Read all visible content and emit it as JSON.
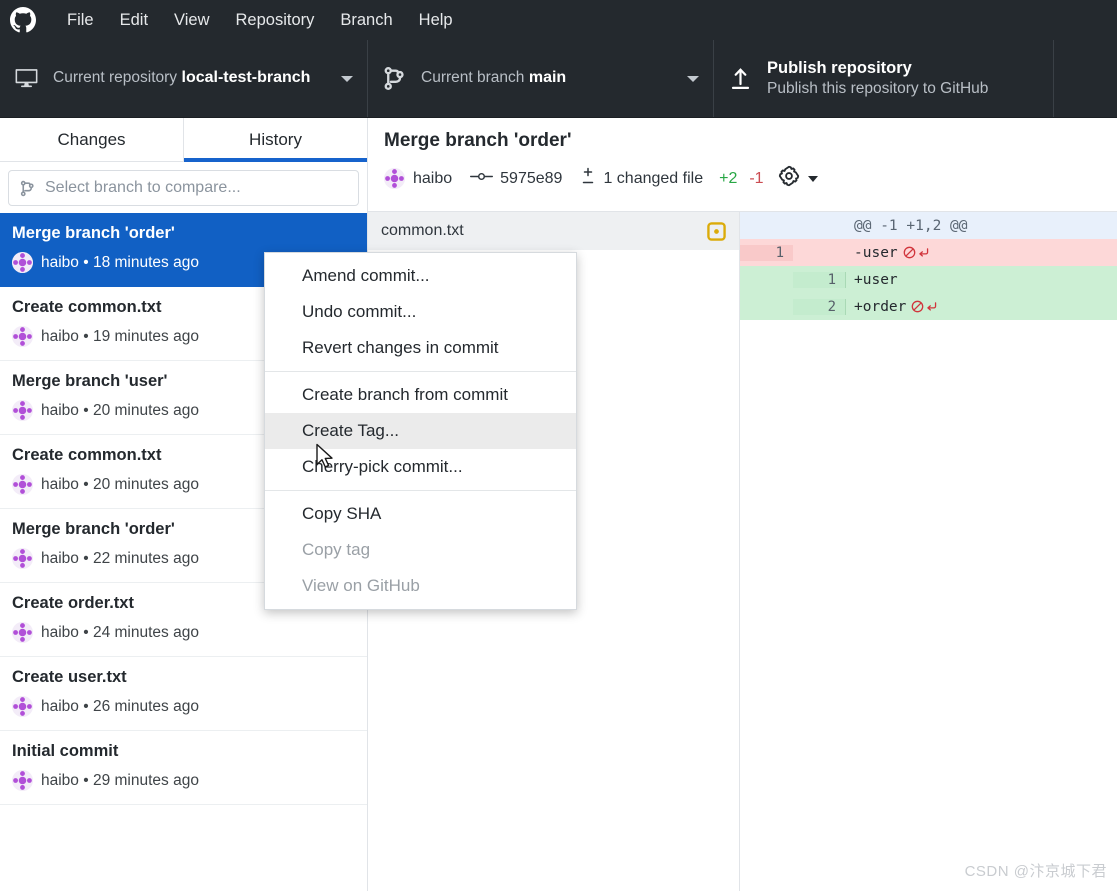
{
  "menubar": {
    "logo_icon": "github-mark-icon",
    "items": [
      {
        "label": "File"
      },
      {
        "label": "Edit"
      },
      {
        "label": "View"
      },
      {
        "label": "Repository"
      },
      {
        "label": "Branch"
      },
      {
        "label": "Help"
      }
    ]
  },
  "toolbar": {
    "repository": {
      "icon": "desktop-repo-icon",
      "label": "Current repository",
      "value": "local-test-branch"
    },
    "branch": {
      "icon": "git-branch-icon",
      "label": "Current branch",
      "value": "main"
    },
    "publish": {
      "icon": "upload-arrow-icon",
      "title": "Publish repository",
      "subtitle": "Publish this repository to GitHub"
    }
  },
  "sidebar": {
    "tabs": [
      {
        "label": "Changes",
        "active": false
      },
      {
        "label": "History",
        "active": true
      }
    ],
    "compare": {
      "icon": "git-branch-icon",
      "placeholder": "Select branch to compare..."
    },
    "commits": [
      {
        "title": "Merge branch 'order'",
        "author": "haibo",
        "time": "18 minutes ago",
        "selected": true
      },
      {
        "title": "Create common.txt",
        "author": "haibo",
        "time": "19 minutes ago",
        "selected": false
      },
      {
        "title": "Merge branch 'user'",
        "author": "haibo",
        "time": "20 minutes ago",
        "selected": false
      },
      {
        "title": "Create common.txt",
        "author": "haibo",
        "time": "20 minutes ago",
        "selected": false
      },
      {
        "title": "Merge branch 'order'",
        "author": "haibo",
        "time": "22 minutes ago",
        "selected": false
      },
      {
        "title": "Create order.txt",
        "author": "haibo",
        "time": "24 minutes ago",
        "selected": false
      },
      {
        "title": "Create user.txt",
        "author": "haibo",
        "time": "26 minutes ago",
        "selected": false
      },
      {
        "title": "Initial commit",
        "author": "haibo",
        "time": "29 minutes ago",
        "selected": false
      }
    ],
    "separator": " • "
  },
  "commit_detail": {
    "title": "Merge branch 'order'",
    "author": "haibo",
    "sha": "5975e89",
    "sha_icon": "git-commit-icon",
    "files_icon": "diff-plus-minus-icon",
    "changed_files": "1 changed file",
    "additions": "+2",
    "deletions": "-1",
    "settings_icon": "gear-icon",
    "files": [
      {
        "name": "common.txt",
        "status_icon": "modified-dot-icon"
      }
    ]
  },
  "diff": {
    "lines": [
      {
        "type": "hunk",
        "old": "",
        "new": "",
        "text": "@@ -1 +1,2 @@",
        "no_newline": false
      },
      {
        "type": "del",
        "old": "1",
        "new": "",
        "text": "-user",
        "no_newline": true
      },
      {
        "type": "add",
        "old": "",
        "new": "1",
        "text": "+user",
        "no_newline": false
      },
      {
        "type": "add",
        "old": "",
        "new": "2",
        "text": "+order",
        "no_newline": true
      }
    ],
    "no_newline_icon": "no-newline-at-eof-icon"
  },
  "context_menu": {
    "groups": [
      [
        {
          "label": "Amend commit...",
          "state": "normal"
        },
        {
          "label": "Undo commit...",
          "state": "normal"
        },
        {
          "label": "Revert changes in commit",
          "state": "normal"
        }
      ],
      [
        {
          "label": "Create branch from commit",
          "state": "normal"
        },
        {
          "label": "Create Tag...",
          "state": "hover"
        },
        {
          "label": "Cherry-pick commit...",
          "state": "normal"
        }
      ],
      [
        {
          "label": "Copy SHA",
          "state": "normal"
        },
        {
          "label": "Copy tag",
          "state": "disabled"
        },
        {
          "label": "View on GitHub",
          "state": "disabled"
        }
      ]
    ]
  },
  "cursor": {
    "icon": "mouse-pointer-icon"
  },
  "watermark": {
    "text": "CSDN @汴京城下君"
  },
  "colors": {
    "chrome_dark": "#24292e",
    "selection_blue": "#1160c4",
    "tab_underline": "#1763cc",
    "addition_green": "#28a745",
    "deletion_red": "#cb4c52",
    "modified_amber": "#dbab09"
  }
}
